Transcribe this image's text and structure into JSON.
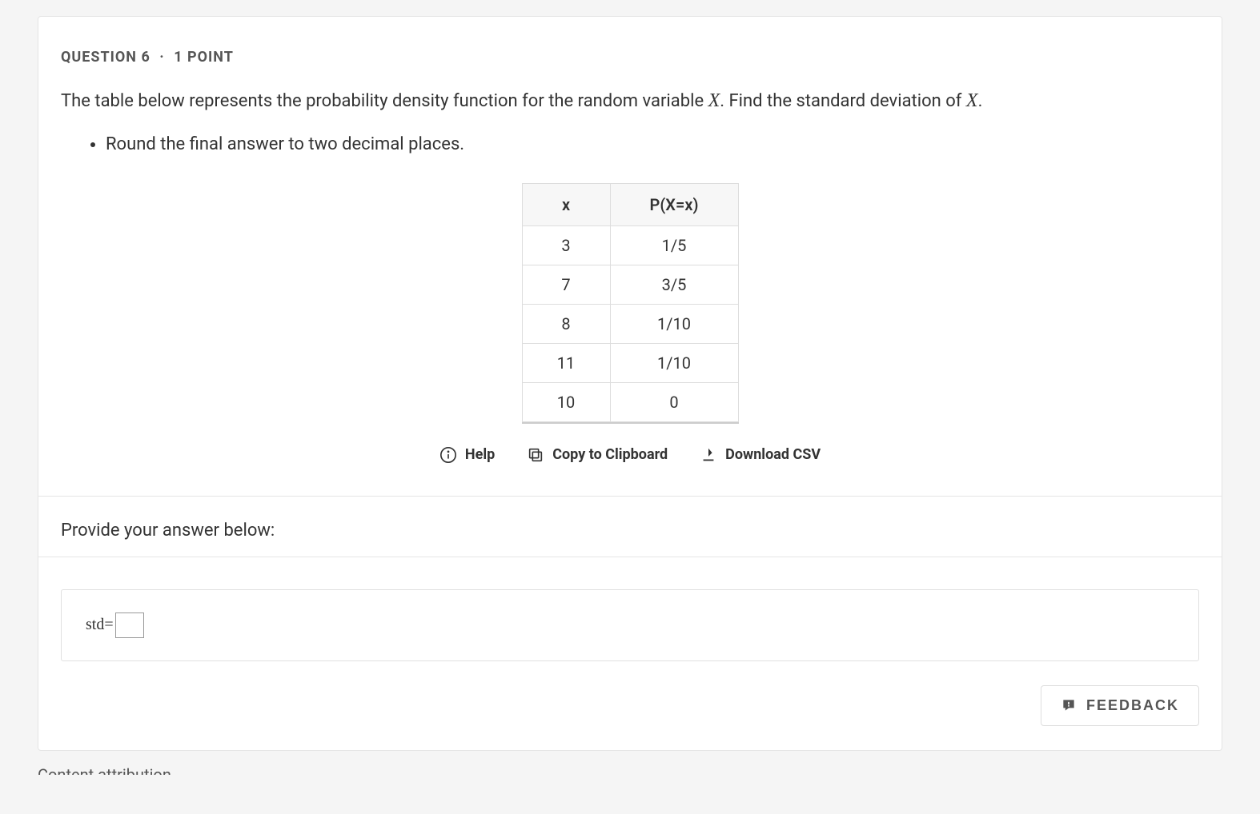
{
  "header": {
    "question_label": "QUESTION 6",
    "points_label": "1 POINT"
  },
  "prompt": {
    "text_before_x1": "The table below represents the probability density function for the random variable ",
    "var1": "X",
    "text_mid": ". Find the standard deviation of ",
    "var2": "X",
    "text_after": "."
  },
  "bullet": "Round the final answer to two decimal places.",
  "table": {
    "headers": [
      "x",
      "P(X=x)"
    ],
    "rows": [
      [
        "3",
        "1/5"
      ],
      [
        "7",
        "3/5"
      ],
      [
        "8",
        "1/10"
      ],
      [
        "11",
        "1/10"
      ],
      [
        "10",
        "0"
      ]
    ]
  },
  "actions": {
    "help": "Help",
    "copy": "Copy to Clipboard",
    "download": "Download CSV"
  },
  "answer": {
    "prompt": "Provide your answer below:",
    "prefix": "std=",
    "value": ""
  },
  "feedback_label": "FEEDBACK",
  "attribution": "Content attribution"
}
